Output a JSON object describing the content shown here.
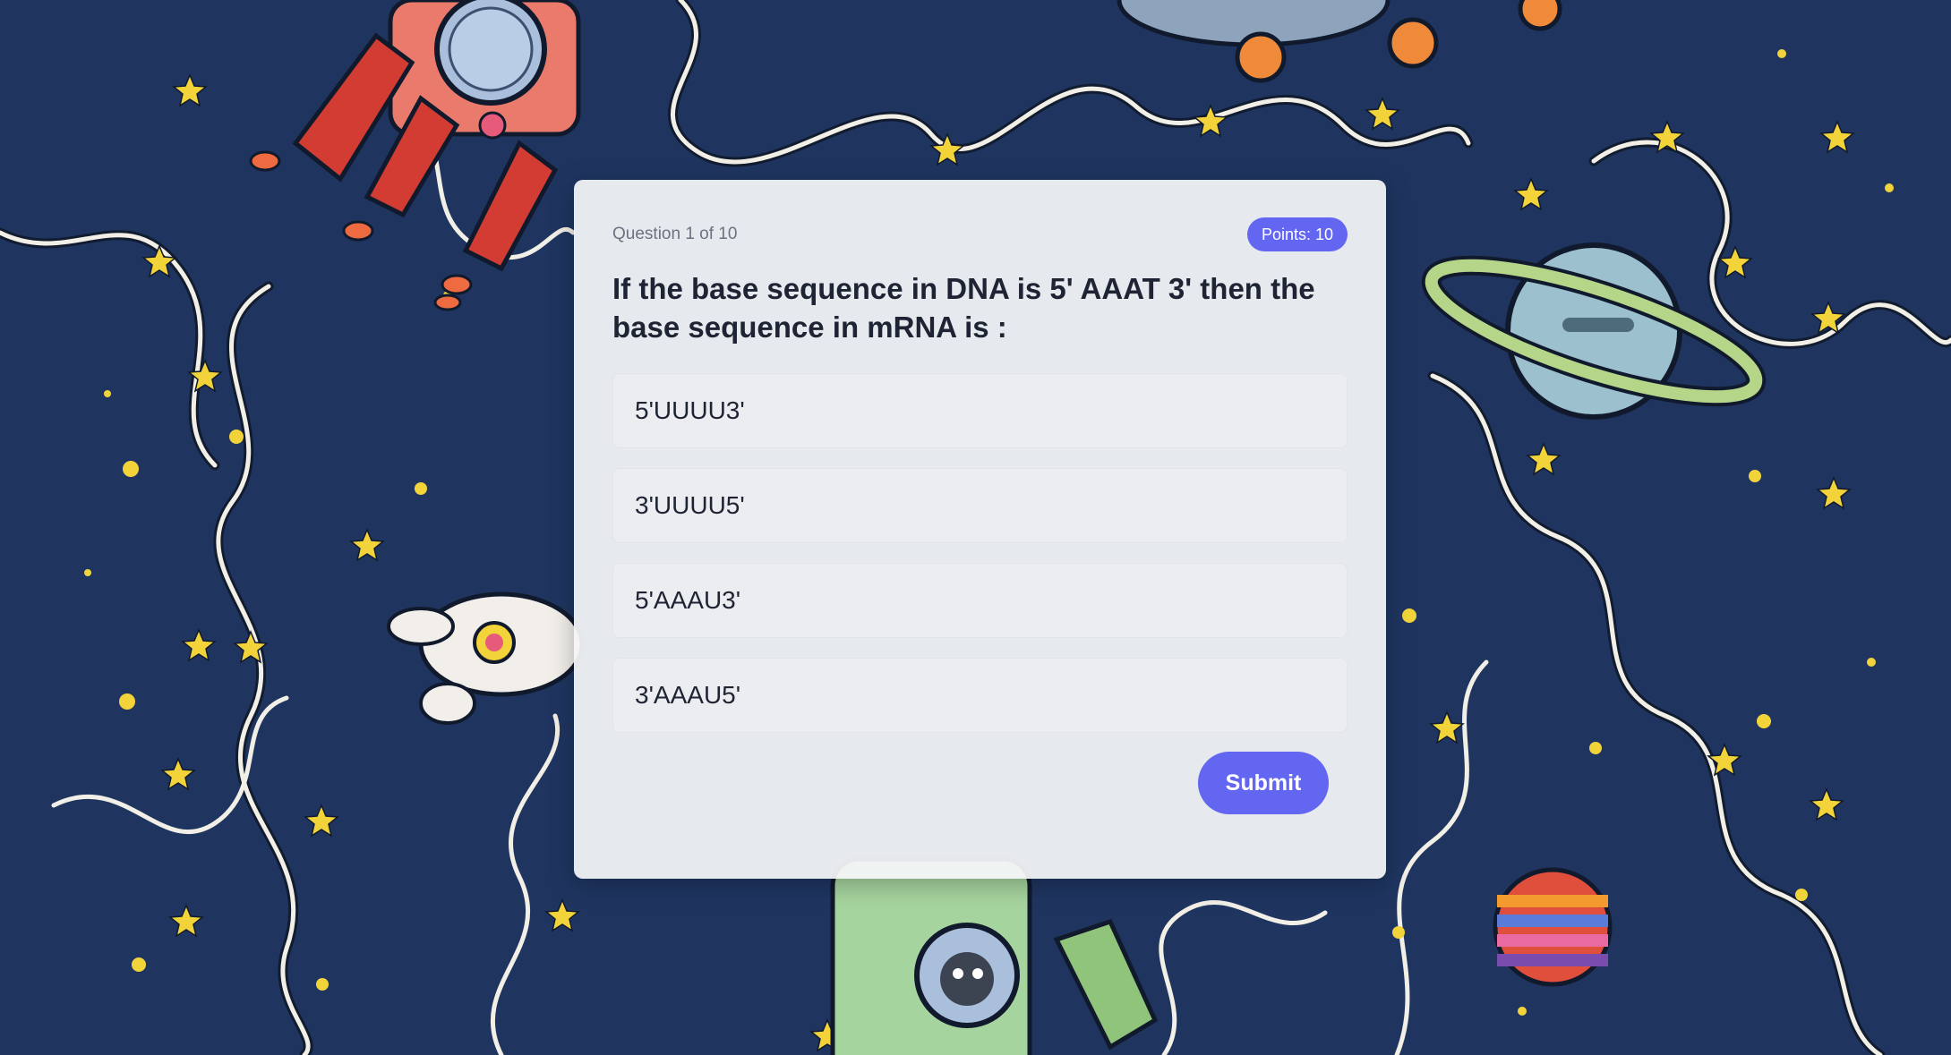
{
  "theme": {
    "accent": "#6366f1",
    "background": "#1f3560",
    "star": "#f2d43a"
  },
  "quiz": {
    "counter": "Question 1 of 10",
    "points": "Points: 10",
    "question": "If the base sequence in DNA is 5' AAAT 3' then the base sequence in mRNA is :",
    "options": [
      {
        "label": "5'UUUU3'"
      },
      {
        "label": "3'UUUU5'"
      },
      {
        "label": "5'AAAU3'"
      },
      {
        "label": "3'AAAU5'"
      }
    ],
    "submit_label": "Submit"
  }
}
